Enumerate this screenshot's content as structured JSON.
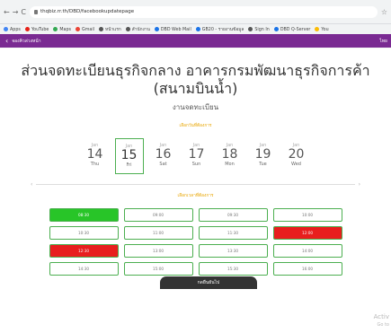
{
  "browser": {
    "url": "thqbiz.rr.th/DBD/facebookupdatepage",
    "nav": [
      "←",
      "→",
      "C"
    ],
    "star": "☆",
    "bookmarks": [
      {
        "label": "Apps",
        "color": "#4285f4"
      },
      {
        "label": "YouTube",
        "color": "#e62117"
      },
      {
        "label": "Maps",
        "color": "#34a853"
      },
      {
        "label": "Gmail",
        "color": "#ea4335"
      },
      {
        "label": "หน้าแรก",
        "color": "#555"
      },
      {
        "label": "สำนักงาน",
        "color": "#555"
      },
      {
        "label": "DBD Web Mail",
        "color": "#1a73e8"
      },
      {
        "label": "GB20 - รายงานข้อมูล",
        "color": "#1a73e8"
      },
      {
        "label": "Sign In",
        "color": "#555"
      },
      {
        "label": "DBD Q-Server",
        "color": "#1a73e8"
      },
      {
        "label": "You",
        "color": "#fbbc05"
      }
    ]
  },
  "header": {
    "back": "‹",
    "title": "จองคิวล่วงหน้า",
    "right_text": "ไทย"
  },
  "office": {
    "title": "ส่วนจดทะเบียนธุรกิจกลาง อาคารกรมพัฒนาธุรกิจการค้า (สนามบินน้ำ)",
    "subtitle": "งานจดทะเบียน"
  },
  "labels": {
    "choose_date": "เลือกวันที่ต้องการ",
    "choose_time": "เลือกเวลาที่ต้องการ",
    "confirm_button": "กดยืนยันไป"
  },
  "dates": [
    {
      "month": "Jan",
      "day": "14",
      "dow": "Thu",
      "selected": false
    },
    {
      "month": "Jan",
      "day": "15",
      "dow": "Fri",
      "selected": true
    },
    {
      "month": "Jan",
      "day": "16",
      "dow": "Sat",
      "selected": false
    },
    {
      "month": "Jan",
      "day": "17",
      "dow": "Sun",
      "selected": false
    },
    {
      "month": "Jan",
      "day": "18",
      "dow": "Mon",
      "selected": false
    },
    {
      "month": "Jan",
      "day": "19",
      "dow": "Tue",
      "selected": false
    },
    {
      "month": "Jan",
      "day": "20",
      "dow": "Wed",
      "selected": false
    }
  ],
  "time_slots": [
    {
      "label": "08:30",
      "state": "selected"
    },
    {
      "label": "09:00",
      "state": "available"
    },
    {
      "label": "09:30",
      "state": "available"
    },
    {
      "label": "10:00",
      "state": "available"
    },
    {
      "label": "10:30",
      "state": "available"
    },
    {
      "label": "11:00",
      "state": "available"
    },
    {
      "label": "11:30",
      "state": "available"
    },
    {
      "label": "12:00",
      "state": "full"
    },
    {
      "label": "12:30",
      "state": "full"
    },
    {
      "label": "13:00",
      "state": "available"
    },
    {
      "label": "13:30",
      "state": "available"
    },
    {
      "label": "14:00",
      "state": "available"
    },
    {
      "label": "14:30",
      "state": "available"
    },
    {
      "label": "15:00",
      "state": "available"
    },
    {
      "label": "15:30",
      "state": "available"
    },
    {
      "label": "16:00",
      "state": "available"
    }
  ],
  "overlay": {
    "line1": "Activ",
    "line2": "Go to"
  }
}
